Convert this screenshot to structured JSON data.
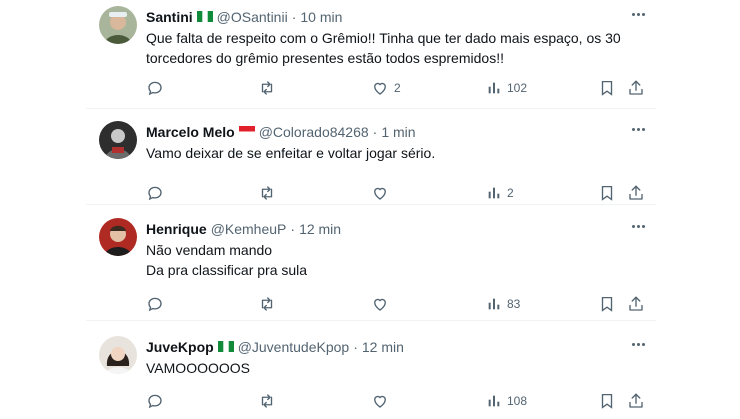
{
  "tweets": [
    {
      "name": "Santini",
      "flag": "nigeria",
      "handle": "@OSantinii",
      "time": "10 min",
      "lines": [
        "Que falta de respeito com o Grêmio!! Tinha que ter dado mais espaço, os 30",
        "torcedores do grêmio presentes estão todos espremidos!!"
      ],
      "likes": "2",
      "views": "102"
    },
    {
      "name": "Marcelo Melo",
      "flag": "red-white",
      "handle": "@Colorado84268",
      "time": "1 min",
      "lines": [
        "Vamo deixar de se enfeitar e voltar jogar sério."
      ],
      "likes": "",
      "views": "2"
    },
    {
      "name": "Henrique",
      "flag": "",
      "handle": "@KemheuP",
      "time": "12 min",
      "lines": [
        "Não vendam mando",
        "Da pra classificar pra sula"
      ],
      "likes": "",
      "views": "83"
    },
    {
      "name": "JuveKpop",
      "flag": "nigeria",
      "handle": "@JuventudeKpop",
      "time": "12 min",
      "lines": [
        "VAMOOOOOOS"
      ],
      "likes": "",
      "views": "108"
    }
  ],
  "separator": "·",
  "colors": {
    "text": "#0f1419",
    "muted": "#536471",
    "divider": "#eff3f4"
  }
}
